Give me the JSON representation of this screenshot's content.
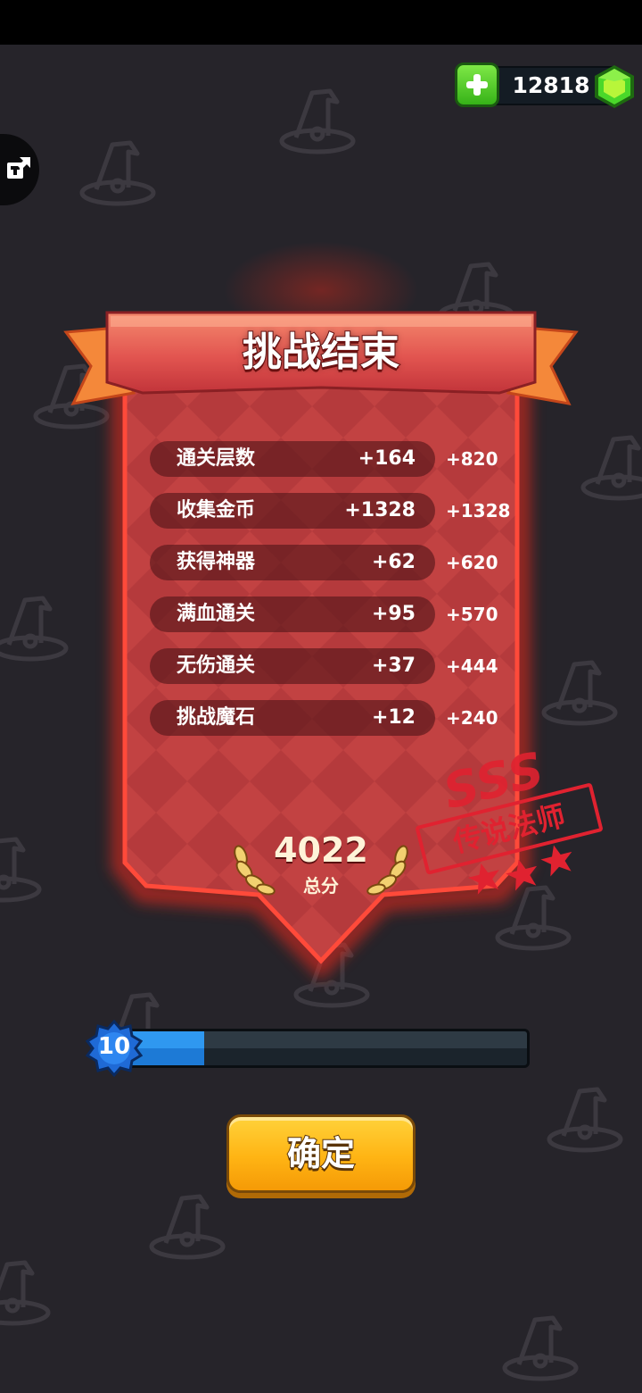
{
  "currency": {
    "gems": "12818",
    "add_icon": "plus-icon",
    "gem_icon": "green-gem-icon",
    "gem_color": "#4ad82a"
  },
  "side_tab": {
    "icon": "puzzle-share-icon"
  },
  "result": {
    "title": "挑战结束",
    "rows": [
      {
        "label": "通关层数",
        "count": "+164",
        "points": "+820"
      },
      {
        "label": "收集金币",
        "count": "+1328",
        "points": "+1328"
      },
      {
        "label": "获得神器",
        "count": "+62",
        "points": "+620"
      },
      {
        "label": "满血通关",
        "count": "+95",
        "points": "+570"
      },
      {
        "label": "无伤通关",
        "count": "+37",
        "points": "+444"
      },
      {
        "label": "挑战魔石",
        "count": "+12",
        "points": "+240"
      }
    ],
    "total_score": "4022",
    "total_label": "总分",
    "grade": "SSS",
    "rank_title": "传说法师",
    "rank_stars": 3
  },
  "level": {
    "number": "10",
    "progress": 0.23,
    "fill_color": "#2f98f0"
  },
  "confirm_button": {
    "label": "确定",
    "color": "#ffb414"
  },
  "colors": {
    "background": "#26242a",
    "banner_red": "#c8403e",
    "stamp_red": "#e02230"
  }
}
